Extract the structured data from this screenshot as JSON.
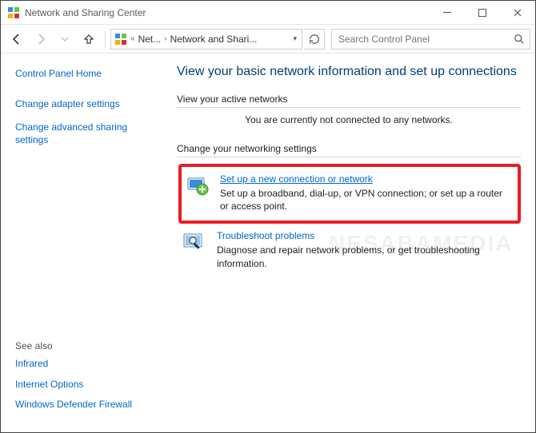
{
  "window": {
    "title": "Network and Sharing Center"
  },
  "nav": {
    "breadcrumb1": "Net...",
    "breadcrumb2": "Network and Shari...",
    "search_placeholder": "Search Control Panel"
  },
  "sidebar": {
    "home": "Control Panel Home",
    "links": [
      "Change adapter settings",
      "Change advanced sharing settings"
    ],
    "seealso_header": "See also",
    "seealso": [
      "Infrared",
      "Internet Options",
      "Windows Defender Firewall"
    ]
  },
  "main": {
    "title": "View your basic network information and set up connections",
    "active_header": "View your active networks",
    "active_msg": "You are currently not connected to any networks.",
    "change_header": "Change your networking settings",
    "options": [
      {
        "label": "Set up a new connection or network",
        "desc": "Set up a broadband, dial-up, or VPN connection; or set up a router or access point."
      },
      {
        "label": "Troubleshoot problems",
        "desc": "Diagnose and repair network problems, or get troubleshooting information."
      }
    ]
  },
  "watermark": "NESABAMEDIA"
}
